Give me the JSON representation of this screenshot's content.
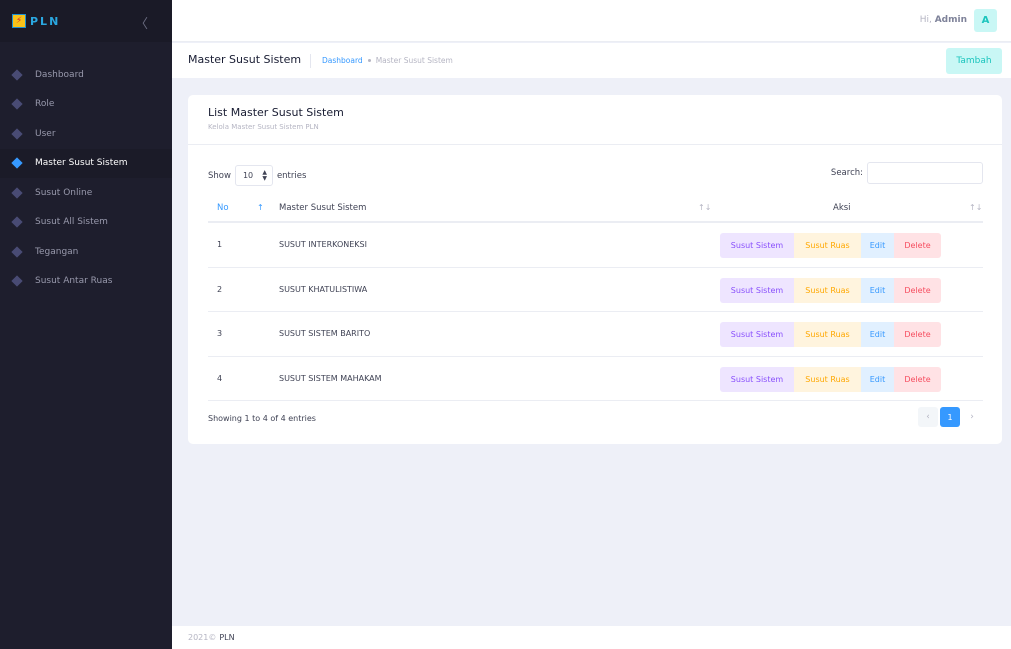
{
  "brand": {
    "logo_glyph": "⚡",
    "name": "PLN",
    "collapse_icon": "chevron-left-icon"
  },
  "sidebar": {
    "items": [
      {
        "label": "Dashboard",
        "active": false
      },
      {
        "label": "Role",
        "active": false
      },
      {
        "label": "User",
        "active": false
      },
      {
        "label": "Master Susut Sistem",
        "active": true
      },
      {
        "label": "Susut Online",
        "active": false
      },
      {
        "label": "Susut All Sistem",
        "active": false
      },
      {
        "label": "Tegangan",
        "active": false
      },
      {
        "label": "Susut Antar Ruas",
        "active": false
      }
    ]
  },
  "header": {
    "greeting": "Hi,",
    "user": "Admin",
    "avatar_letter": "A"
  },
  "subheader": {
    "title": "Master Susut Sistem",
    "breadcrumb": [
      "Dashboard",
      "Master Susut Sistem"
    ],
    "add_label": "Tambah"
  },
  "card": {
    "title": "List Master Susut Sistem",
    "subtitle": "Kelola Master Susut Sistem PLN",
    "show_label": "Show",
    "entries_value": "10",
    "entries_label": "entries",
    "search_label": "Search:",
    "search_value": "",
    "columns": [
      "No",
      "Master Susut Sistem",
      "Aksi"
    ],
    "rows": [
      {
        "no": "1",
        "name": "SUSUT INTERKONEKSI"
      },
      {
        "no": "2",
        "name": "SUSUT KHATULISTIWA"
      },
      {
        "no": "3",
        "name": "SUSUT SISTEM BARITO"
      },
      {
        "no": "4",
        "name": "SUSUT SISTEM MAHAKAM"
      }
    ],
    "action_labels": {
      "sistem": "Susut Sistem",
      "ruas": "Susut Ruas",
      "edit": "Edit",
      "delete": "Delete"
    },
    "info": "Showing 1 to 4 of 4 entries",
    "pagination": {
      "prev": "‹",
      "current": "1",
      "next": "›"
    }
  },
  "footer": {
    "year": "2021©",
    "brand": "PLN"
  },
  "colors": {
    "accent": "#3699ff",
    "sidebar_bg": "#1e1e2d",
    "success_light": "#c9f7f5",
    "success": "#1bc5bd"
  }
}
